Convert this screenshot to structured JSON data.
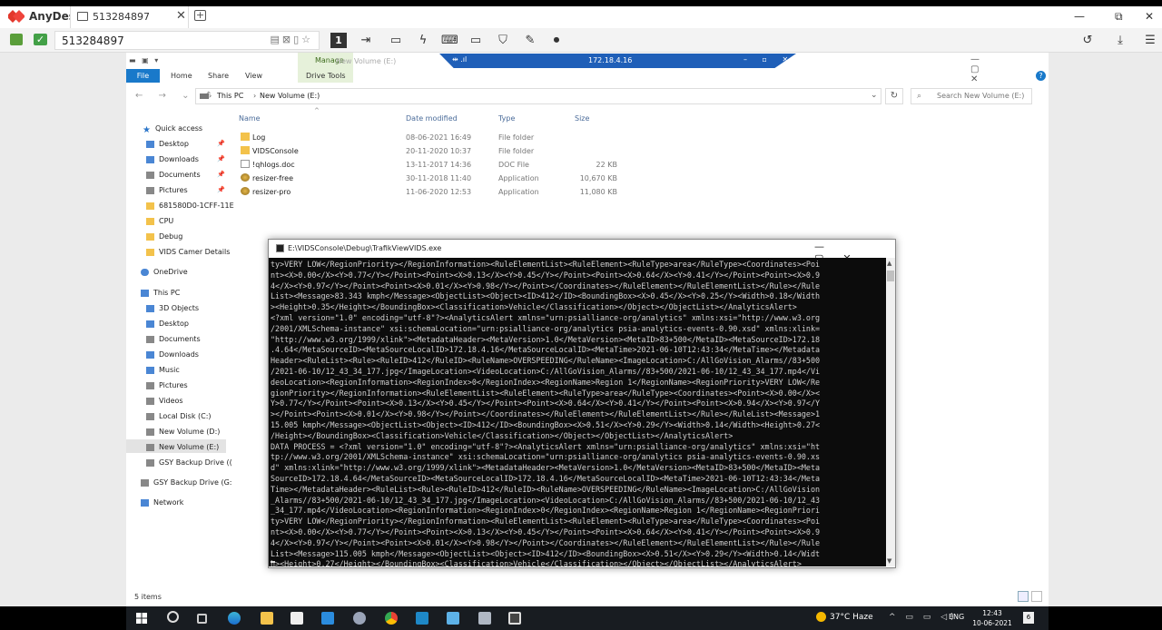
{
  "anydesk": {
    "brand": "AnyDesk",
    "tab_label": "513284897",
    "tab_close": "✕",
    "address": "513284897",
    "minimize": "—",
    "restore": "⧉",
    "close": "✕",
    "display_number": "1"
  },
  "overlay": {
    "ip": "172.18.4.16"
  },
  "explorer": {
    "ribbon_tabs": [
      "File",
      "Home",
      "Share",
      "View"
    ],
    "manage_label": "Manage",
    "drive_tools_label": "Drive Tools",
    "window_title": "New Volume (E:)",
    "path_root": "This PC",
    "path_current": "New Volume (E:)",
    "search_placeholder": "Search New Volume (E:)",
    "columns": {
      "name": "Name",
      "date": "Date modified",
      "type": "Type",
      "size": "Size"
    },
    "files": [
      {
        "name": "Log",
        "date": "08-06-2021 16:49",
        "type": "File folder",
        "size": "",
        "kind": "folder"
      },
      {
        "name": "VIDSConsole",
        "date": "20-11-2020 10:37",
        "type": "File folder",
        "size": "",
        "kind": "folder"
      },
      {
        "name": "!qhlogs.doc",
        "date": "13-11-2017 14:36",
        "type": "DOC File",
        "size": "22 KB",
        "kind": "doc"
      },
      {
        "name": "resizer-free",
        "date": "30-11-2018 11:40",
        "type": "Application",
        "size": "10,670 KB",
        "kind": "app"
      },
      {
        "name": "resizer-pro",
        "date": "11-06-2020 12:53",
        "type": "Application",
        "size": "11,080 KB",
        "kind": "app"
      }
    ],
    "items_count": "5 items",
    "nav": {
      "quick_access": "Quick access",
      "qa_items": [
        "Desktop",
        "Downloads",
        "Documents",
        "Pictures",
        "681580D0-1CFF-11E",
        "CPU",
        "Debug",
        "VIDS Camer Details"
      ],
      "onedrive": "OneDrive",
      "this_pc": "This PC",
      "pc_items": [
        "3D Objects",
        "Desktop",
        "Documents",
        "Downloads",
        "Music",
        "Pictures",
        "Videos",
        "Local Disk (C:)",
        "New Volume (D:)",
        "New Volume (E:)",
        "GSY Backup Drive (("
      ],
      "gsy_drive": "GSY Backup Drive (G:",
      "network": "Network"
    }
  },
  "console": {
    "title": "E:\\VIDSConsole\\Debug\\TrafikViewVIDS.exe",
    "lines": [
      "ty>VERY LOW</RegionPriority></RegionInformation><RuleElementList><RuleElement><RuleType>area</RuleType><Coordinates><Poi",
      "nt><X>0.00</X><Y>0.77</Y></Point><Point><X>0.13</X><Y>0.45</Y></Point><Point><X>0.64</X><Y>0.41</Y></Point><Point><X>0.9",
      "4</X><Y>0.97</Y></Point><Point><X>0.01</X><Y>0.98</Y></Point></Coordinates></RuleElement></RuleElementList></Rule></Rule",
      "List><Message>83.343 kmph</Message><ObjectList><Object><ID>412</ID><BoundingBox><X>0.45</X><Y>0.25</Y><Width>0.18</Width",
      "><Height>0.35</Height></BoundingBox><Classification>Vehicle</Classification></Object></ObjectList></AnalyticsAlert>",
      "<?xml version=\"1.0\" encoding=\"utf-8\"?><AnalyticsAlert xmlns=\"urn:psialliance-org/analytics\" xmlns:xsi=\"http://www.w3.org",
      "/2001/XMLSchema-instance\" xsi:schemaLocation=\"urn:psialliance-org/analytics psia-analytics-events-0.90.xsd\" xmlns:xlink=",
      "\"http://www.w3.org/1999/xlink\"><MetadataHeader><MetaVersion>1.0</MetaVersion><MetaID>83+500</MetaID><MetaSourceID>172.18",
      ".4.64</MetaSourceID><MetaSourceLocalID>172.18.4.16</MetaSourceLocalID><MetaTime>2021-06-10T12:43:34</MetaTime></Metadata",
      "Header><RuleList><Rule><RuleID>412</RuleID><RuleName>OVERSPEEDING</RuleName><ImageLocation>C:/AllGoVision_Alarms//83+500",
      "/2021-06-10/12_43_34_177.jpg</ImageLocation><VideoLocation>C:/AllGoVision_Alarms//83+500/2021-06-10/12_43_34_177.mp4</Vi",
      "deoLocation><RegionInformation><RegionIndex>0</RegionIndex><RegionName>Region 1</RegionName><RegionPriority>VERY LOW</Re",
      "gionPriority></RegionInformation><RuleElementList><RuleElement><RuleType>area</RuleType><Coordinates><Point><X>0.00</X><",
      "Y>0.77</Y></Point><Point><X>0.13</X><Y>0.45</Y></Point><Point><X>0.64</X><Y>0.41</Y></Point><Point><X>0.94</X><Y>0.97</Y",
      "></Point><Point><X>0.01</X><Y>0.98</Y></Point></Coordinates></RuleElement></RuleElementList></Rule></RuleList><Message>1",
      "15.005 kmph</Message><ObjectList><Object><ID>412</ID><BoundingBox><X>0.51</X><Y>0.29</Y><Width>0.14</Width><Height>0.27<",
      "/Height></BoundingBox><Classification>Vehicle</Classification></Object></ObjectList></AnalyticsAlert>",
      "DATA PROCESS = <?xml version=\"1.0\" encoding=\"utf-8\"?><AnalyticsAlert xmlns=\"urn:psialliance-org/analytics\" xmlns:xsi=\"ht",
      "tp://www.w3.org/2001/XMLSchema-instance\" xsi:schemaLocation=\"urn:psialliance-org/analytics psia-analytics-events-0.90.xs",
      "d\" xmlns:xlink=\"http://www.w3.org/1999/xlink\"><MetadataHeader><MetaVersion>1.0</MetaVersion><MetaID>83+500</MetaID><Meta",
      "SourceID>172.18.4.64</MetaSourceID><MetaSourceLocalID>172.18.4.16</MetaSourceLocalID><MetaTime>2021-06-10T12:43:34</Meta",
      "Time></MetadataHeader><RuleList><Rule><RuleID>412</RuleID><RuleName>OVERSPEEDING</RuleName><ImageLocation>C:/AllGoVision",
      "_Alarms//83+500/2021-06-10/12_43_34_177.jpg</ImageLocation><VideoLocation>C:/AllGoVision_Alarms//83+500/2021-06-10/12_43",
      "_34_177.mp4</VideoLocation><RegionInformation><RegionIndex>0</RegionIndex><RegionName>Region 1</RegionName><RegionPriori",
      "ty>VERY LOW</RegionPriority></RegionInformation><RuleElementList><RuleElement><RuleType>area</RuleType><Coordinates><Poi",
      "nt><X>0.00</X><Y>0.77</Y></Point><Point><X>0.13</X><Y>0.45</Y></Point><Point><X>0.64</X><Y>0.41</Y></Point><Point><X>0.9",
      "4</X><Y>0.97</Y></Point><Point><X>0.01</X><Y>0.98</Y></Point></Coordinates></RuleElement></RuleElementList></Rule></Rule",
      "List><Message>115.005 kmph</Message><ObjectList><Object><ID>412</ID><BoundingBox><X>0.51</X><Y>0.29</Y><Width>0.14</Widt",
      "h><Height>0.27</Height></BoundingBox><Classification>Vehicle</Classification></Object></ObjectList></AnalyticsAlert>"
    ]
  },
  "taskbar": {
    "weather": "37°C  Haze",
    "lang": "ENG",
    "time": "12:43",
    "date": "10-06-2021",
    "notifications": "6"
  }
}
